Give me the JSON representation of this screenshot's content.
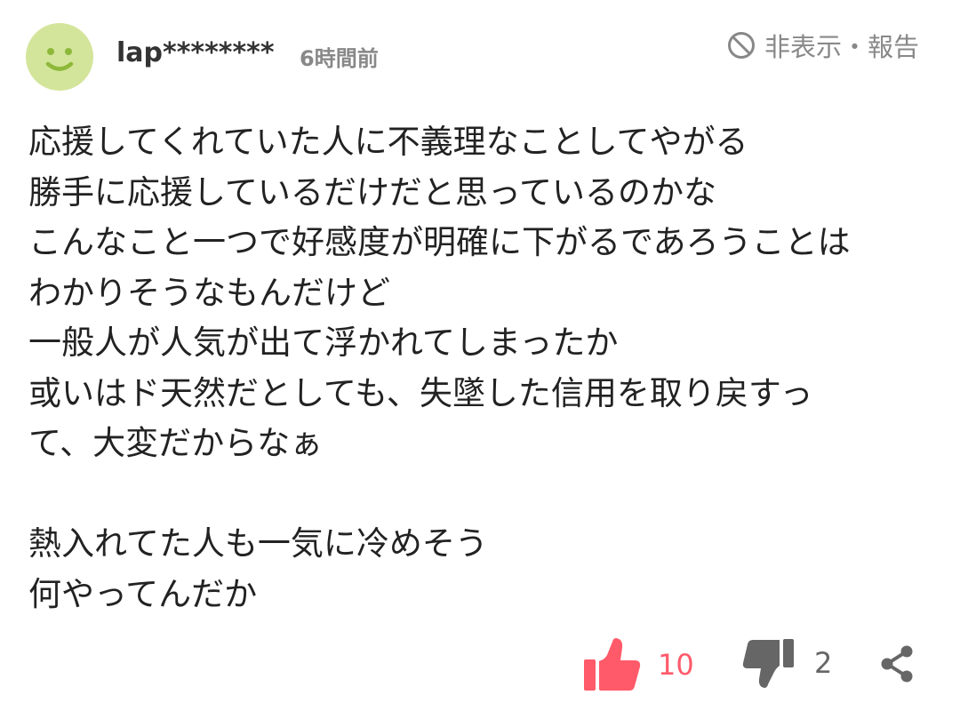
{
  "comment": {
    "username": "lap********",
    "timestamp": "6時間前",
    "report_label": "非表示・報告",
    "lines": [
      "応援してくれていた人に不義理なことしてやがる",
      "勝手に応援しているだけだと思っているのかな",
      "こんなこと一つで好感度が明確に下がるであろうことは",
      "わかりそうなもんだけど",
      "一般人が人気が出て浮かれてしまったか",
      "或いはド天然だとしても、失墜した信用を取り戻すっ",
      "て、大変だからなぁ",
      "",
      "熱入れてた人も一気に冷めそう",
      "何やってんだか"
    ],
    "likes": "10",
    "dislikes": "2"
  },
  "colors": {
    "avatar_bg": "#d3e59a",
    "avatar_face": "#8db83a",
    "like": "#ff5a6a",
    "dislike": "#666666",
    "muted": "#888888"
  },
  "icons": {
    "avatar": "smiley-face-icon",
    "report": "prohibited-circle-icon",
    "like": "thumbs-up-icon",
    "dislike": "thumbs-down-icon",
    "share": "share-icon"
  }
}
